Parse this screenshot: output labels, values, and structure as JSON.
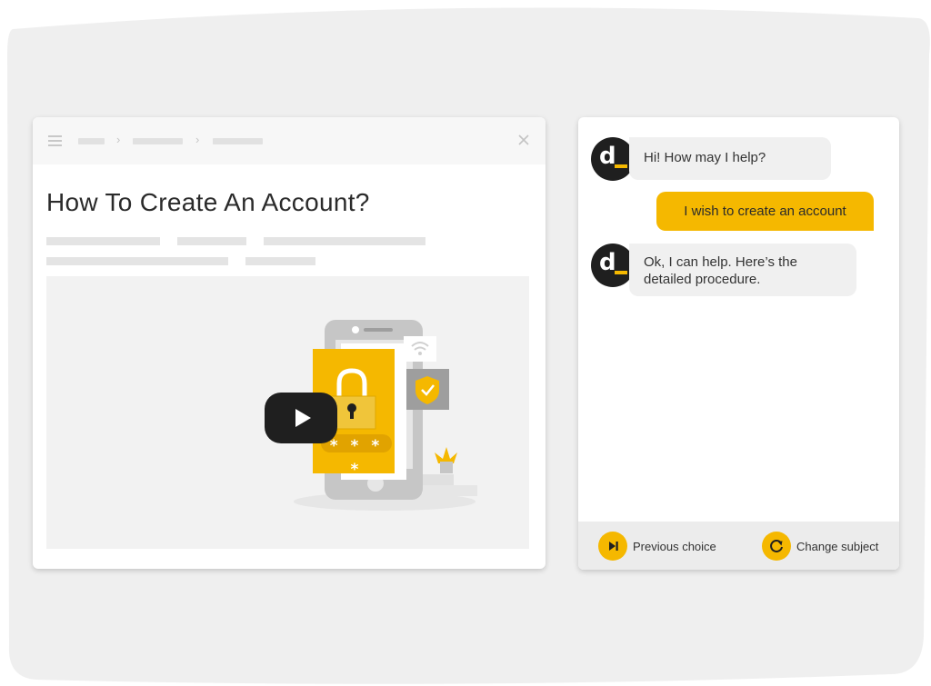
{
  "colors": {
    "accent": "#f5b800",
    "dark": "#1f1f1f",
    "background_shape": "#efefef"
  },
  "article": {
    "title": "How To Create An Account?",
    "menu_icon": "hamburger-menu-icon",
    "close_icon": "close-icon",
    "video": {
      "play_icon": "play-icon",
      "illustration": "phone-with-padlock-illustration",
      "pin_mask": "* * * *"
    }
  },
  "chat": {
    "avatar_letter": "d",
    "messages": [
      {
        "from": "bot",
        "text": "Hi! How may I help?"
      },
      {
        "from": "user",
        "text": "I wish to create an account"
      },
      {
        "from": "bot",
        "text": "Ok, I can help. Here’s the detailed procedure."
      }
    ],
    "footer": {
      "previous_choice": {
        "label": "Previous choice",
        "icon": "skip-next-icon"
      },
      "change_subject": {
        "label": "Change subject",
        "icon": "refresh-icon"
      }
    }
  }
}
